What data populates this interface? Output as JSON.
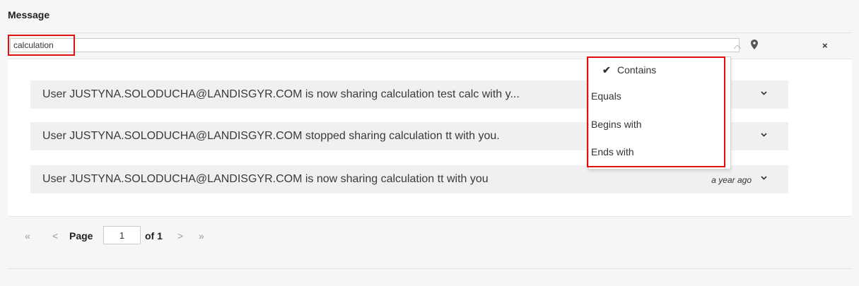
{
  "header": {
    "title": "Message"
  },
  "filter": {
    "value": "calculation",
    "pin_icon": "map-marker-icon",
    "clear_label": "×"
  },
  "messages": [
    {
      "text": "User JUSTYNA.SOLODUCHA@LANDISGYR.COM is now sharing calculation test calc with y...",
      "time": ""
    },
    {
      "text": "User JUSTYNA.SOLODUCHA@LANDISGYR.COM stopped sharing calculation tt with you.",
      "time": ""
    },
    {
      "text": "User JUSTYNA.SOLODUCHA@LANDISGYR.COM is now sharing calculation tt with you",
      "time": "a year ago"
    }
  ],
  "filter_menu": {
    "items": [
      {
        "label": "Contains",
        "checked": true
      },
      {
        "label": "Equals",
        "checked": false
      },
      {
        "label": "Begins with",
        "checked": false
      },
      {
        "label": "Ends with",
        "checked": false
      }
    ],
    "check_glyph": "✔"
  },
  "pagination": {
    "first": "«",
    "prev": "<",
    "page_label": "Page",
    "page_value": "1",
    "of_label": "of 1",
    "next": ">",
    "last": "»"
  },
  "colors": {
    "highlight": "#e01010",
    "row_bg": "#f0f0f0",
    "panel_bg": "#ffffff"
  }
}
